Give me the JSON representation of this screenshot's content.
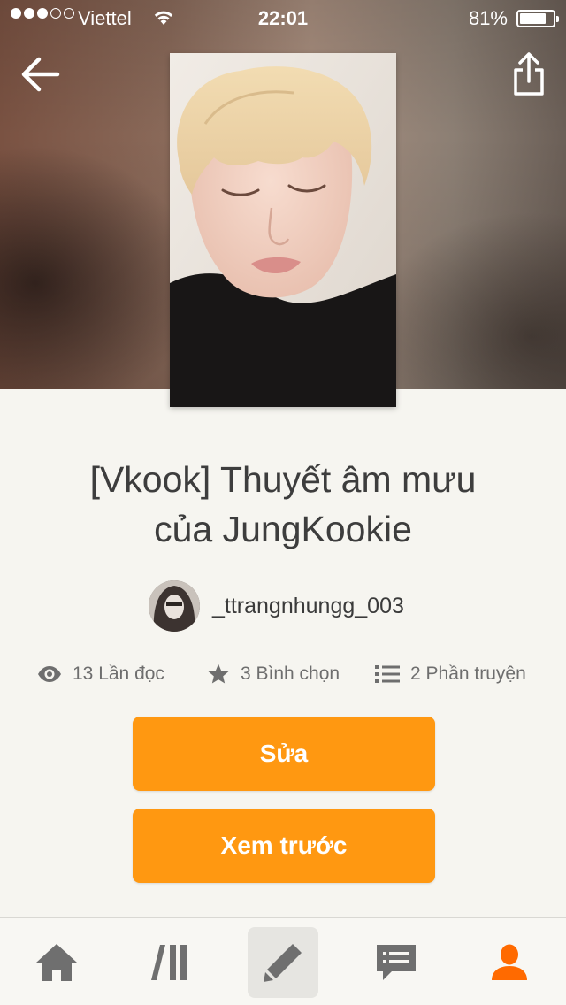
{
  "status_bar": {
    "carrier": "Viettel",
    "time": "22:01",
    "battery": "81%",
    "battery_level": 0.81,
    "signal_bars": 3,
    "signal_max": 5
  },
  "story": {
    "title_line1": "[Vkook] Thuyết âm mưu",
    "title_line2": "của JungKookie",
    "author": "_ttrangnhungg_003"
  },
  "stats": {
    "reads": "13 Lần đọc",
    "votes": "3 Bình chọn",
    "parts": "2 Phần truyện"
  },
  "actions": {
    "edit_label": "Sửa",
    "preview_label": "Xem trước"
  },
  "icons": {
    "back": "arrow-left-icon",
    "share": "share-icon",
    "reads": "eye-icon",
    "votes": "star-icon",
    "parts": "list-icon"
  },
  "tabs": [
    {
      "icon": "home-icon",
      "active": false
    },
    {
      "icon": "library-icon",
      "active": false
    },
    {
      "icon": "pencil-icon",
      "active": true
    },
    {
      "icon": "chat-icon",
      "active": false
    },
    {
      "icon": "user-icon",
      "active": false
    }
  ],
  "colors": {
    "accent": "#ff9811",
    "background": "#f6f5f0",
    "tab_icon": "#6f6f6f",
    "profile_tab": "#ff6a00"
  }
}
